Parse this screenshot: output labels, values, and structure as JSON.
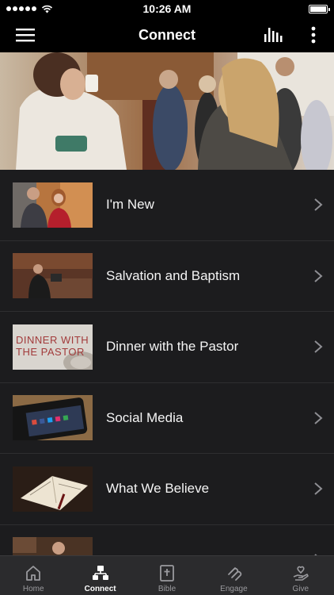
{
  "status": {
    "time": "10:26 AM"
  },
  "nav": {
    "title": "Connect"
  },
  "items": [
    {
      "label": "I'm New"
    },
    {
      "label": "Salvation and Baptism"
    },
    {
      "label": "Dinner with the Pastor",
      "thumb_text_line1": "DINNER WITH",
      "thumb_text_line2": "THE PASTOR"
    },
    {
      "label": "Social Media"
    },
    {
      "label": "What We Believe"
    },
    {
      "label": ""
    }
  ],
  "tabs": [
    {
      "label": "Home",
      "icon": "home-icon"
    },
    {
      "label": "Connect",
      "icon": "connect-icon",
      "active": true
    },
    {
      "label": "Bible",
      "icon": "bible-icon"
    },
    {
      "label": "Engage",
      "icon": "engage-icon"
    },
    {
      "label": "Give",
      "icon": "give-icon"
    }
  ],
  "colors": {
    "background": "#1c1c1e",
    "bar": "#000000",
    "tab_bar": "#2b2b2d"
  }
}
